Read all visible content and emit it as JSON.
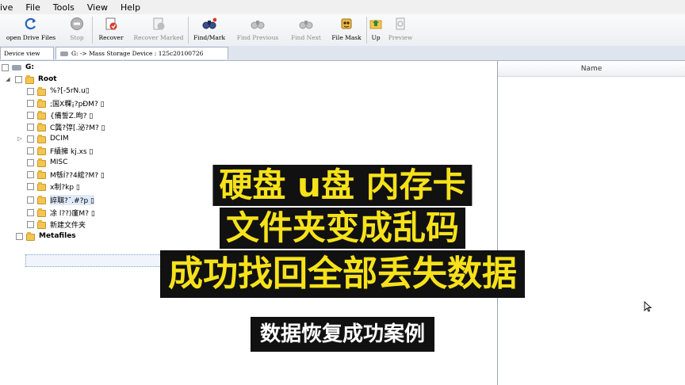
{
  "menu": [
    "ive",
    "File",
    "Tools",
    "View",
    "Help"
  ],
  "toolbar": [
    {
      "label": "open Drive Files",
      "icon": "open-drive-icon",
      "enabled": true
    },
    {
      "label": "Stop",
      "icon": "stop-icon",
      "enabled": false
    },
    {
      "label": "Recover",
      "icon": "recover-icon",
      "enabled": true
    },
    {
      "label": "Recover Marked",
      "icon": "recover-marked-icon",
      "enabled": false
    },
    {
      "label": "Find/Mark",
      "icon": "binoculars-icon",
      "enabled": true
    },
    {
      "label": "Find Previous",
      "icon": "find-previous-icon",
      "enabled": false
    },
    {
      "label": "Find Next",
      "icon": "find-next-icon",
      "enabled": false
    },
    {
      "label": "File Mask",
      "icon": "file-mask-icon",
      "enabled": true
    },
    {
      "label": "Up",
      "icon": "up-folder-icon",
      "enabled": true
    },
    {
      "label": "Preview",
      "icon": "preview-icon",
      "enabled": false
    }
  ],
  "tabs": {
    "device_view": "Device view",
    "path": "G:  -> Mass Storage Device : 125c20100726"
  },
  "tree": {
    "drive": "G:",
    "root": "Root",
    "items": [
      "%?[-5rN.u▯",
      ";国X粿¡?pÐM?  ▯",
      "{備誓Z.昫?  ▯",
      "C龔?弴[.泌?M?  ▯",
      "DCIM",
      "F績擁             kj.xs  ▯",
      "MISC",
      "M綔Í??4綋?M?  ▯",
      "x制?kp  ▯",
      "誶聑?˘.#?p  ▯",
      "凃     l??)廑M?  ▯",
      "新建文件夹"
    ],
    "metafiles": "Metafiles"
  },
  "right_pane": {
    "column_name": "Name"
  },
  "captions": {
    "line1": "硬盘 u盘 内存卡",
    "line2": "文件夹变成乱码",
    "line3": "成功找回全部丢失数据",
    "subtitle": "数据恢复成功案例"
  },
  "colors": {
    "caption_text": "#f7e21a",
    "caption_bg": "#111111",
    "folder": "#f3c552"
  }
}
